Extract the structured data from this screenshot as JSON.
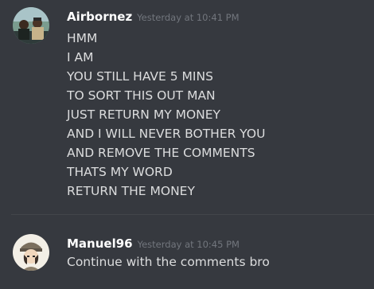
{
  "messages": [
    {
      "username": "Airbornez",
      "timestamp": "Yesterday at 10:41 PM",
      "avatar_icon": "user-avatar-icon",
      "lines": [
        "HMM",
        "I AM",
        "YOU STILL HAVE 5 MINS",
        "TO SORT THIS OUT MAN",
        "JUST RETURN MY MONEY",
        "AND I WILL NEVER BOTHER YOU",
        "AND REMOVE THE COMMENTS",
        "THATS MY WORD",
        "RETURN THE MONEY"
      ]
    },
    {
      "username": "Manuel96",
      "timestamp": "Yesterday at 10:45 PM",
      "avatar_icon": "user-avatar-icon",
      "lines": [
        "Continue with the comments bro"
      ]
    }
  ],
  "colors": {
    "background": "#36393f",
    "username": "#ffffff",
    "timestamp": "#72767d",
    "message_text": "#dcddde",
    "divider": "#42454a"
  }
}
